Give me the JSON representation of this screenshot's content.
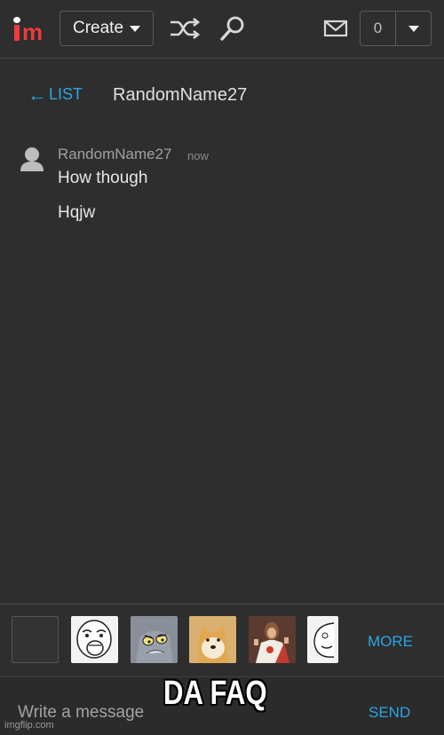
{
  "header": {
    "logo": "imgflip logo",
    "create_label": "Create",
    "notification_count": "0"
  },
  "conversation": {
    "back_label": "LIST",
    "title": "RandomName27"
  },
  "message": {
    "sender": "RandomName27",
    "time": "now",
    "lines": [
      "How though",
      "Hqjw"
    ]
  },
  "memes": {
    "more_label": "MORE",
    "thumbnails": [
      "blank",
      "lol-face",
      "tom-cat",
      "doge",
      "buddy-christ",
      "rage-face"
    ]
  },
  "composer": {
    "placeholder": "Write a message",
    "send_label": "SEND"
  },
  "overlay": {
    "caption": "DA FAQ",
    "watermark": "imgflip.com"
  },
  "colors": {
    "background": "#2e2e2e",
    "accent": "#2aa6e0",
    "brand_red": "#ef3b3b"
  }
}
